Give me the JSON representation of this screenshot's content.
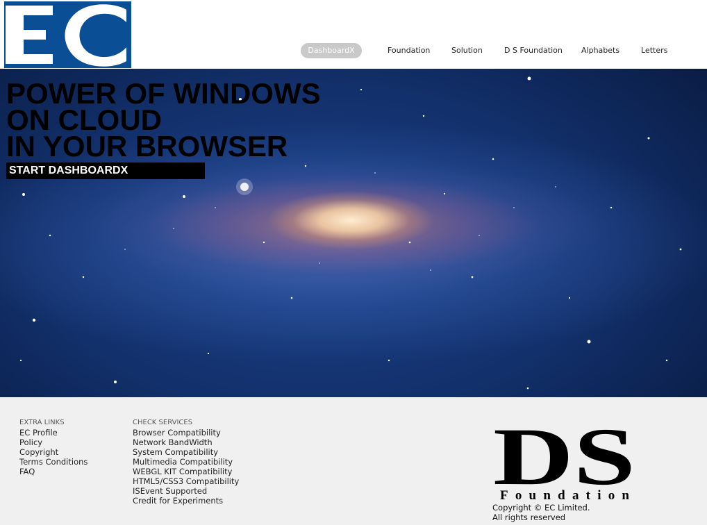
{
  "header": {
    "logo_text": "EC",
    "nav": [
      {
        "label": "DashboardX",
        "active": true
      },
      {
        "label": "Foundation",
        "active": false
      },
      {
        "label": "Solution",
        "active": false
      },
      {
        "label": "D S Foundation",
        "active": false
      },
      {
        "label": "Alphabets",
        "active": false
      },
      {
        "label": "Letters",
        "active": false
      }
    ]
  },
  "hero": {
    "title_lines": [
      "POWER OF WINDOWS",
      "ON CLOUD",
      "IN YOUR BROWSER"
    ],
    "cta_label": "START DASHBOARDX"
  },
  "footer": {
    "extra_links": {
      "heading": "EXTRA LINKS",
      "items": [
        "EC Profile",
        "Policy",
        "Copyright",
        "Terms Conditions",
        "FAQ"
      ]
    },
    "check_services": {
      "heading": "CHECK SERVICES",
      "items": [
        "Browser Compatibility",
        "Network BandWidth",
        "System Compatibility",
        "Multimedia Compatibility",
        "WEBGL KIT Compatibility",
        "HTML5/CSS3 Compatibility",
        "ISEvent Supported",
        "Credit for Experiments"
      ]
    },
    "ds_logo": {
      "letters": "DS",
      "word": "Foundation"
    },
    "copyright_line1": "Copyright © EC Limited.",
    "copyright_line2": "All rights reserved"
  },
  "colors": {
    "brand_blue": "#0a4f96",
    "nav_active_bg": "#c9c9c9",
    "footer_bg": "#f0f0f0",
    "hero_cta_bg": "#000000"
  }
}
